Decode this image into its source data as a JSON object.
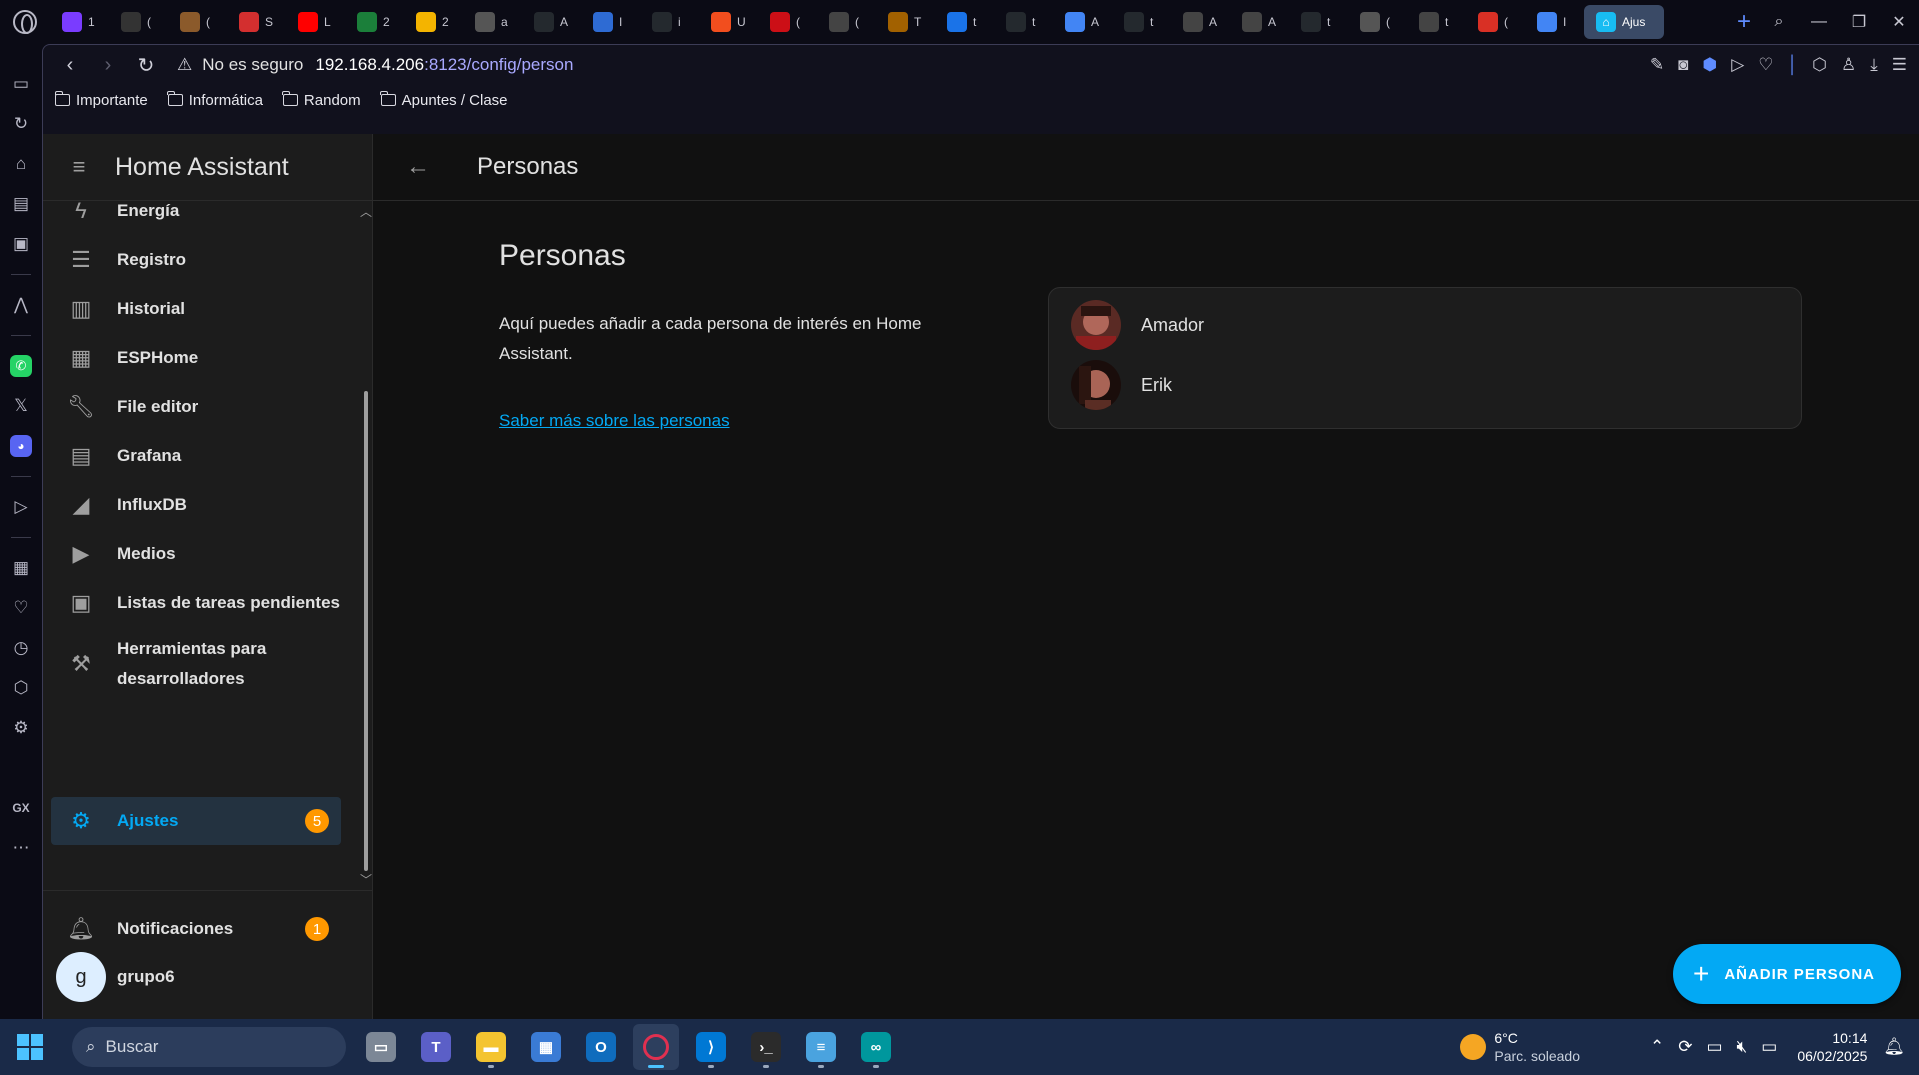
{
  "browser": {
    "tabs": [
      {
        "icon": "opera-gx-icon",
        "letter": "1",
        "color": "#7a3cff"
      },
      {
        "icon": "pen-icon",
        "letter": "(",
        "color": "#333333"
      },
      {
        "icon": "cookie-icon",
        "letter": "(",
        "color": "#8b5a2b"
      },
      {
        "icon": "cards-icon",
        "letter": "S",
        "color": "#d32f2f"
      },
      {
        "icon": "youtube-icon",
        "letter": "L",
        "color": "#ff0000"
      },
      {
        "icon": "a-green-icon",
        "letter": "2",
        "color": "#1b7f3a"
      },
      {
        "icon": "image-icon",
        "letter": "2",
        "color": "#f4b400"
      },
      {
        "icon": "globe-icon",
        "letter": "a",
        "color": "#555555"
      },
      {
        "icon": "github-icon",
        "letter": "A",
        "color": "#24292e"
      },
      {
        "icon": "photo-icon",
        "letter": "I",
        "color": "#2e6bd3"
      },
      {
        "icon": "github-icon",
        "letter": "i",
        "color": "#24292e"
      },
      {
        "icon": "figma-icon",
        "letter": "U",
        "color": "#f24e1e"
      },
      {
        "icon": "opera-red-icon",
        "letter": "(",
        "color": "#cc0f16"
      },
      {
        "icon": "openai-icon",
        "letter": "(",
        "color": "#444444"
      },
      {
        "icon": "arch-icon",
        "letter": "T",
        "color": "#a26100"
      },
      {
        "icon": "contacts-icon",
        "letter": "t",
        "color": "#1a73e8"
      },
      {
        "icon": "github-icon",
        "letter": "t",
        "color": "#24292e"
      },
      {
        "icon": "docs-icon",
        "letter": "A",
        "color": "#4285f4"
      },
      {
        "icon": "github-icon",
        "letter": "t",
        "color": "#24292e"
      },
      {
        "icon": "openai-icon",
        "letter": "A",
        "color": "#444444"
      },
      {
        "icon": "openai-icon",
        "letter": "A",
        "color": "#444444"
      },
      {
        "icon": "github-icon",
        "letter": "t",
        "color": "#24292e"
      },
      {
        "icon": "globe-icon",
        "letter": "(",
        "color": "#555555"
      },
      {
        "icon": "openai-icon",
        "letter": "t",
        "color": "#444444"
      },
      {
        "icon": "gmail-icon",
        "letter": "(",
        "color": "#d93025"
      },
      {
        "icon": "docs-icon",
        "letter": "I",
        "color": "#4285f4"
      }
    ],
    "active_tab": {
      "icon": "home-assistant-icon",
      "label": "Ajus"
    },
    "url": {
      "security": "No es seguro",
      "host": "192.168.4.206",
      "path": ":8123/config/person"
    },
    "bookmarks": [
      "Importante",
      "Informática",
      "Random",
      "Apuntes / Clase"
    ]
  },
  "ha": {
    "app_title": "Home Assistant",
    "nav": [
      {
        "icon": "lightning-icon",
        "label": "Energía"
      },
      {
        "icon": "list-icon",
        "label": "Registro"
      },
      {
        "icon": "chart-icon",
        "label": "Historial"
      },
      {
        "icon": "chip-icon",
        "label": "ESPHome"
      },
      {
        "icon": "wrench-icon",
        "label": "File editor"
      },
      {
        "icon": "grafana-icon",
        "label": "Grafana"
      },
      {
        "icon": "area-chart-icon",
        "label": "InfluxDB"
      },
      {
        "icon": "media-icon",
        "label": "Medios"
      },
      {
        "icon": "clipboard-icon",
        "label": "Listas de tareas pendientes"
      },
      {
        "icon": "hammer-icon",
        "label": "Herramientas para desarrolladores"
      }
    ],
    "settings": {
      "label": "Ajustes",
      "badge": "5"
    },
    "notifications": {
      "label": "Notificaciones",
      "badge": "1"
    },
    "user": {
      "initial": "g",
      "name": "grupo6"
    },
    "page_title": "Personas",
    "section": {
      "title": "Personas",
      "description": "Aquí puedes añadir a cada persona de interés en Home Assistant.",
      "link": "Saber más sobre las personas"
    },
    "persons": [
      {
        "name": "Amador"
      },
      {
        "name": "Erik"
      }
    ],
    "fab_label": "AÑADIR PERSONA"
  },
  "taskbar": {
    "search_placeholder": "Buscar",
    "weather": {
      "temp": "6°C",
      "desc": "Parc. soleado"
    },
    "time": "10:14",
    "date": "06/02/2025"
  },
  "colors": {
    "accent": "#03a9f4",
    "badge": "#ff9800"
  }
}
